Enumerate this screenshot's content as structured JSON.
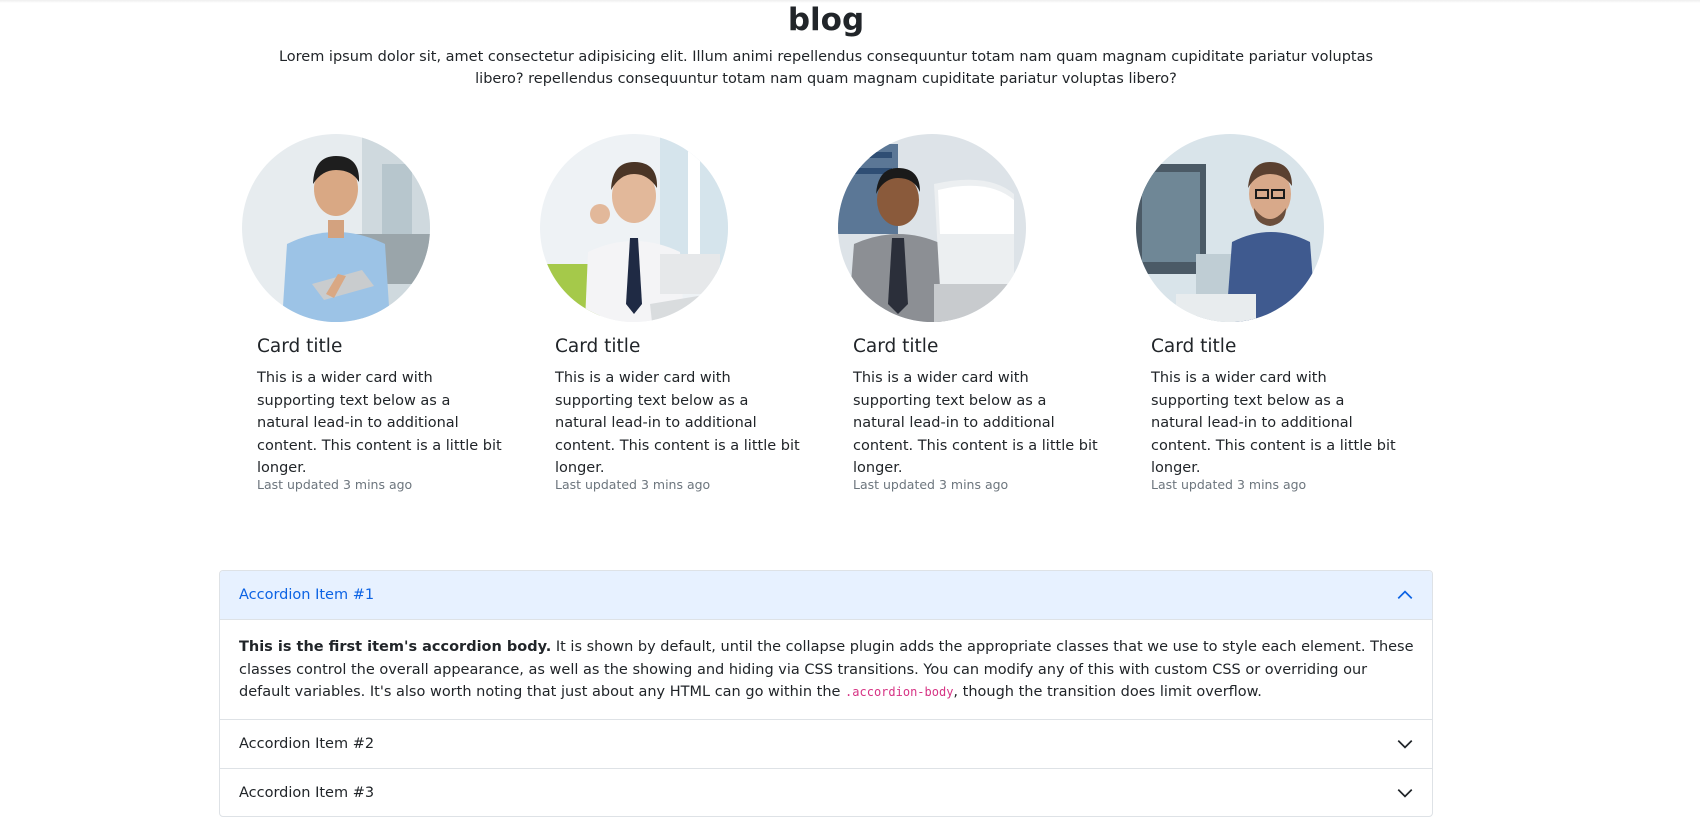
{
  "header": {
    "title": "blog",
    "intro": "Lorem ipsum dolor sit, amet consectetur adipisicing elit. Illum animi repellendus consequuntur totam nam quam magnam cupiditate pariatur voluptas libero? repellendus consequuntur totam nam quam magnam cupiditate pariatur voluptas libero?"
  },
  "cards": [
    {
      "title": "Card title",
      "text": "This is a wider card with supporting text below as a natural lead-in to additional content. This content is a little bit longer.",
      "updated": "Last updated 3 mins ago",
      "image": "person-holding-laptop-photo"
    },
    {
      "title": "Card title",
      "text": "This is a wider card with supporting text below as a natural lead-in to additional content. This content is a little bit longer.",
      "updated": "Last updated 3 mins ago",
      "image": "person-at-desk-ok-gesture-photo"
    },
    {
      "title": "Card title",
      "text": "This is a wider card with supporting text below as a natural lead-in to additional content. This content is a little bit longer.",
      "updated": "Last updated 3 mins ago",
      "image": "person-at-computer-monitor-photo"
    },
    {
      "title": "Card title",
      "text": "This is a wider card with supporting text below as a natural lead-in to additional content. This content is a little bit longer.",
      "updated": "Last updated 3 mins ago",
      "image": "person-with-glasses-at-computer-photo"
    }
  ],
  "accordion": {
    "items": [
      {
        "label": "Accordion Item #1",
        "expanded": true,
        "icon": "chevron-up-icon"
      },
      {
        "label": "Accordion Item #2",
        "expanded": false,
        "icon": "chevron-down-icon"
      },
      {
        "label": "Accordion Item #3",
        "expanded": false,
        "icon": "chevron-down-icon"
      }
    ],
    "body": {
      "strong": "This is the first item's accordion body.",
      "text_1": " It is shown by default, until the collapse plugin adds the appropriate classes that we use to style each element. These classes control the overall appearance, as well as the showing and hiding via CSS transitions. You can modify any of this with custom CSS or overriding our default variables. It's also worth noting that just about any HTML can go within the ",
      "code": ".accordion-body",
      "text_2": ", though the transition does limit overflow."
    }
  },
  "colors": {
    "text": "#212529",
    "muted": "#6c757d",
    "accordion_active_bg": "#e7f1ff",
    "accordion_active_text": "#0c63e4",
    "code": "#d63384",
    "border": "#dee2e6"
  }
}
